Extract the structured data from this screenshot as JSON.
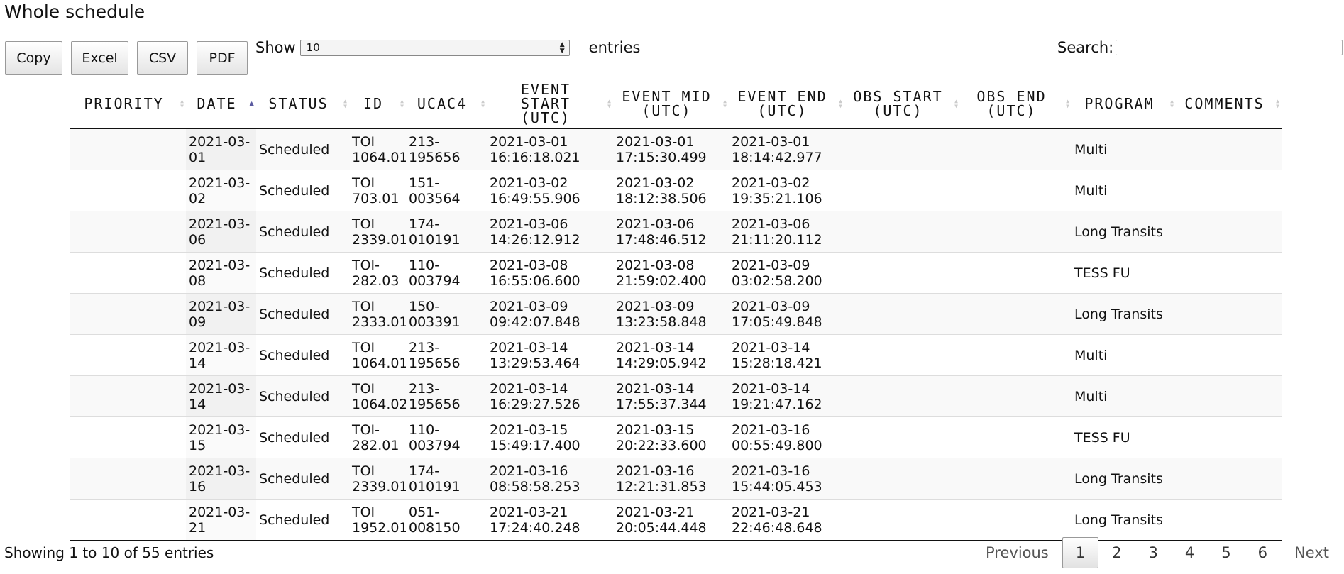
{
  "page": {
    "title": "Whole schedule"
  },
  "buttons": [
    "Copy",
    "Excel",
    "CSV",
    "PDF"
  ],
  "length": {
    "show_label": "Show",
    "selected": "10",
    "entries_label": "entries"
  },
  "search": {
    "label": "Search:",
    "value": ""
  },
  "table": {
    "columns": [
      {
        "label": "PRIORITY",
        "sort": "both"
      },
      {
        "label": "DATE",
        "sort": "asc"
      },
      {
        "label": "STATUS",
        "sort": "both"
      },
      {
        "label": "ID",
        "sort": "both"
      },
      {
        "label": "UCAC4",
        "sort": "both"
      },
      {
        "label": "EVENT START (UTC)",
        "sort": "both"
      },
      {
        "label": "EVENT MID (UTC)",
        "sort": "both"
      },
      {
        "label": "EVENT END (UTC)",
        "sort": "both"
      },
      {
        "label": "OBS START (UTC)",
        "sort": "both"
      },
      {
        "label": "OBS END (UTC)",
        "sort": "both"
      },
      {
        "label": "PROGRAM",
        "sort": "both"
      },
      {
        "label": "COMMENTS",
        "sort": "both"
      }
    ],
    "rows": [
      {
        "priority": "",
        "date": "2021-03-01",
        "status": "Scheduled",
        "id": "TOI 1064.01",
        "ucac4": "213-195656",
        "event_start": "2021-03-01 16:16:18.021",
        "event_mid": "2021-03-01 17:15:30.499",
        "event_end": "2021-03-01 18:14:42.977",
        "obs_start": "",
        "obs_end": "",
        "program": "Multi",
        "comments": ""
      },
      {
        "priority": "",
        "date": "2021-03-02",
        "status": "Scheduled",
        "id": "TOI 703.01",
        "ucac4": "151-003564",
        "event_start": "2021-03-02 16:49:55.906",
        "event_mid": "2021-03-02 18:12:38.506",
        "event_end": "2021-03-02 19:35:21.106",
        "obs_start": "",
        "obs_end": "",
        "program": "Multi",
        "comments": ""
      },
      {
        "priority": "",
        "date": "2021-03-06",
        "status": "Scheduled",
        "id": "TOI 2339.01",
        "ucac4": "174-010191",
        "event_start": "2021-03-06 14:26:12.912",
        "event_mid": "2021-03-06 17:48:46.512",
        "event_end": "2021-03-06 21:11:20.112",
        "obs_start": "",
        "obs_end": "",
        "program": "Long Transits",
        "comments": ""
      },
      {
        "priority": "",
        "date": "2021-03-08",
        "status": "Scheduled",
        "id": "TOI-282.03",
        "ucac4": "110-003794",
        "event_start": "2021-03-08 16:55:06.600",
        "event_mid": "2021-03-08 21:59:02.400",
        "event_end": "2021-03-09 03:02:58.200",
        "obs_start": "",
        "obs_end": "",
        "program": "TESS FU",
        "comments": ""
      },
      {
        "priority": "",
        "date": "2021-03-09",
        "status": "Scheduled",
        "id": "TOI 2333.01",
        "ucac4": "150-003391",
        "event_start": "2021-03-09 09:42:07.848",
        "event_mid": "2021-03-09 13:23:58.848",
        "event_end": "2021-03-09 17:05:49.848",
        "obs_start": "",
        "obs_end": "",
        "program": "Long Transits",
        "comments": ""
      },
      {
        "priority": "",
        "date": "2021-03-14",
        "status": "Scheduled",
        "id": "TOI 1064.01",
        "ucac4": "213-195656",
        "event_start": "2021-03-14 13:29:53.464",
        "event_mid": "2021-03-14 14:29:05.942",
        "event_end": "2021-03-14 15:28:18.421",
        "obs_start": "",
        "obs_end": "",
        "program": "Multi",
        "comments": ""
      },
      {
        "priority": "",
        "date": "2021-03-14",
        "status": "Scheduled",
        "id": "TOI 1064.02",
        "ucac4": "213-195656",
        "event_start": "2021-03-14 16:29:27.526",
        "event_mid": "2021-03-14 17:55:37.344",
        "event_end": "2021-03-14 19:21:47.162",
        "obs_start": "",
        "obs_end": "",
        "program": "Multi",
        "comments": ""
      },
      {
        "priority": "",
        "date": "2021-03-15",
        "status": "Scheduled",
        "id": "TOI-282.01",
        "ucac4": "110-003794",
        "event_start": "2021-03-15 15:49:17.400",
        "event_mid": "2021-03-15 20:22:33.600",
        "event_end": "2021-03-16 00:55:49.800",
        "obs_start": "",
        "obs_end": "",
        "program": "TESS FU",
        "comments": ""
      },
      {
        "priority": "",
        "date": "2021-03-16",
        "status": "Scheduled",
        "id": "TOI 2339.01",
        "ucac4": "174-010191",
        "event_start": "2021-03-16 08:58:58.253",
        "event_mid": "2021-03-16 12:21:31.853",
        "event_end": "2021-03-16 15:44:05.453",
        "obs_start": "",
        "obs_end": "",
        "program": "Long Transits",
        "comments": ""
      },
      {
        "priority": "",
        "date": "2021-03-21",
        "status": "Scheduled",
        "id": "TOI 1952.01",
        "ucac4": "051-008150",
        "event_start": "2021-03-21 17:24:40.248",
        "event_mid": "2021-03-21 20:05:44.448",
        "event_end": "2021-03-21 22:46:48.648",
        "obs_start": "",
        "obs_end": "",
        "program": "Long Transits",
        "comments": ""
      }
    ]
  },
  "info": "Showing 1 to 10 of 55 entries",
  "pagination": {
    "previous": "Previous",
    "pages": [
      "1",
      "2",
      "3",
      "4",
      "5",
      "6"
    ],
    "current": "1",
    "next": "Next"
  },
  "icons": {
    "sort_both": "▲▼",
    "sort_asc": "▲"
  }
}
